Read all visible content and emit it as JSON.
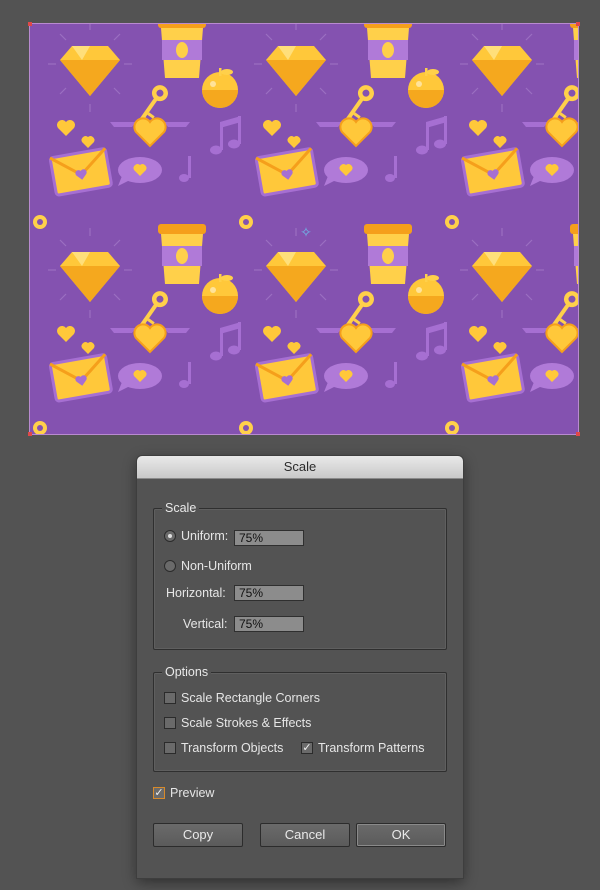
{
  "dialog": {
    "title": "Scale",
    "scale_group": {
      "legend": "Scale",
      "uniform_label": "Uniform:",
      "uniform_value": "75%",
      "non_uniform_label": "Non-Uniform",
      "horizontal_label": "Horizontal:",
      "horizontal_value": "75%",
      "vertical_label": "Vertical:",
      "vertical_value": "75%",
      "selected": "uniform"
    },
    "options_group": {
      "legend": "Options",
      "scale_rectangle_corners": {
        "label": "Scale Rectangle Corners",
        "checked": false
      },
      "scale_strokes_effects": {
        "label": "Scale Strokes & Effects",
        "checked": false
      },
      "transform_objects": {
        "label": "Transform Objects",
        "checked": false
      },
      "transform_patterns": {
        "label": "Transform Patterns",
        "checked": true
      }
    },
    "preview": {
      "label": "Preview",
      "checked": true
    },
    "buttons": {
      "copy": "Copy",
      "cancel": "Cancel",
      "ok": "OK"
    },
    "colors": {
      "accent": "#d88a2a",
      "panel": "#535353",
      "field": "#8c8c8c"
    }
  },
  "artboard": {
    "background_color": "#8452b0",
    "motif_color": "#ffc83a",
    "motif_shade": "#f59f1b",
    "icons": [
      "diamond-icon",
      "coffee-cup-icon",
      "key-icon",
      "apple-icon",
      "heart-icon",
      "winged-heart-icon",
      "envelope-icon",
      "music-note-icon",
      "speech-bubble-icon"
    ]
  }
}
